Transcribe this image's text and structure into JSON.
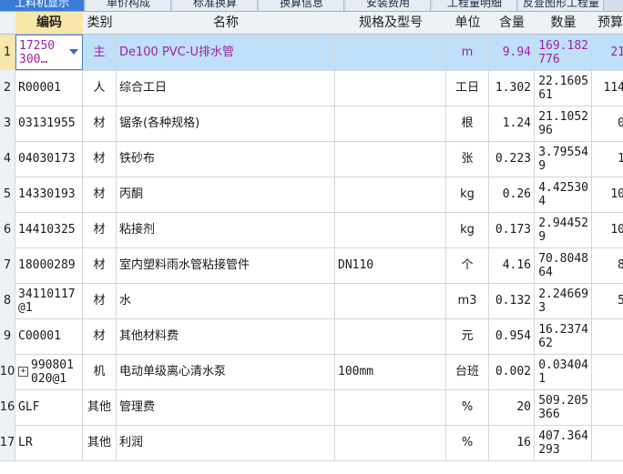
{
  "tabs": [
    "工料机显示",
    "单价构成",
    "标准换算",
    "换算信息",
    "安装费用",
    "工程量明细",
    "反查图形工程量"
  ],
  "headers": {
    "rownum": "",
    "code": "编码",
    "type": "类别",
    "name": "名称",
    "spec": "规格及型号",
    "unit": "单位",
    "content": "含量",
    "qty": "数量",
    "budget": "预算"
  },
  "rows": [
    {
      "no": "1",
      "code": "17250\n300…",
      "type": "主",
      "name": "De100 PVC-U排水管",
      "spec": "",
      "unit": "m",
      "content": "9.94",
      "qty": "169.182\n776",
      "budget": "21"
    },
    {
      "no": "2",
      "code": "R00001",
      "type": "人",
      "name": "综合工日",
      "spec": "",
      "unit": "工日",
      "content": "1.302",
      "qty": "22.1605\n61",
      "budget": "114"
    },
    {
      "no": "3",
      "code": "03131955",
      "type": "材",
      "name": "锯条(各种规格)",
      "spec": "",
      "unit": "根",
      "content": "1.24",
      "qty": "21.1052\n96",
      "budget": "0"
    },
    {
      "no": "4",
      "code": "04030173",
      "type": "材",
      "name": "铁砂布",
      "spec": "",
      "unit": "张",
      "content": "0.223",
      "qty": "3.79554\n9",
      "budget": "1"
    },
    {
      "no": "5",
      "code": "14330193",
      "type": "材",
      "name": "丙酮",
      "spec": "",
      "unit": "kg",
      "content": "0.26",
      "qty": "4.42530\n4",
      "budget": "10"
    },
    {
      "no": "6",
      "code": "14410325",
      "type": "材",
      "name": "粘接剂",
      "spec": "",
      "unit": "kg",
      "content": "0.173",
      "qty": "2.94452\n9",
      "budget": "10"
    },
    {
      "no": "7",
      "code": "18000289",
      "type": "材",
      "name": "室内塑料雨水管粘接管件",
      "spec": "DN110",
      "unit": "个",
      "content": "4.16",
      "qty": "70.8048\n64",
      "budget": "8"
    },
    {
      "no": "8",
      "code": "34110117\n@1",
      "type": "材",
      "name": "水",
      "spec": "",
      "unit": "m3",
      "content": "0.132",
      "qty": "2.24669\n3",
      "budget": "5"
    },
    {
      "no": "9",
      "code": "C00001",
      "type": "材",
      "name": "其他材料费",
      "spec": "",
      "unit": "元",
      "content": "0.954",
      "qty": "16.2374\n62",
      "budget": ""
    },
    {
      "no": "10",
      "code": "990801\n020@1",
      "type": "机",
      "name": "电动单级离心清水泵",
      "spec": "100mm",
      "unit": "台班",
      "content": "0.002",
      "qty": "0.03404\n1",
      "budget": ""
    },
    {
      "no": "16",
      "code": "GLF",
      "type": "其他",
      "name": "管理费",
      "spec": "",
      "unit": "%",
      "content": "20",
      "qty": "509.205\n366",
      "budget": ""
    },
    {
      "no": "17",
      "code": "LR",
      "type": "其他",
      "name": "利润",
      "spec": "",
      "unit": "%",
      "content": "16",
      "qty": "407.364\n293",
      "budget": ""
    }
  ]
}
